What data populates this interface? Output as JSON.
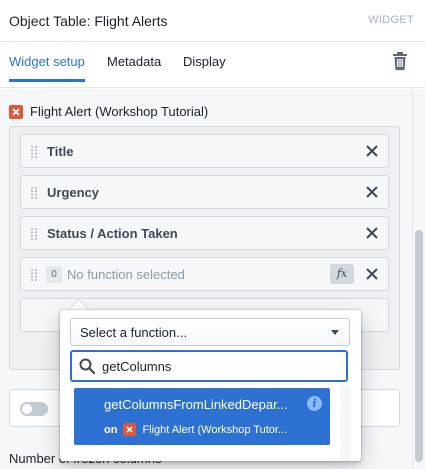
{
  "header": {
    "title": "Object Table: Flight Alerts",
    "badge": "WIDGET"
  },
  "tabs": [
    {
      "label": "Widget setup",
      "active": true
    },
    {
      "label": "Metadata",
      "active": false
    },
    {
      "label": "Display",
      "active": false
    }
  ],
  "object_type": {
    "label": "Flight Alert (Workshop Tutorial)"
  },
  "columns": [
    {
      "label": "Title"
    },
    {
      "label": "Urgency"
    },
    {
      "label": "Status / Action Taken"
    }
  ],
  "function_column": {
    "index": "0",
    "label": "No function selected",
    "fx": "fx"
  },
  "popover": {
    "select_value": "Select a function...",
    "search_value": "getColumns",
    "result": {
      "name": "getColumnsFromLinkedDepar...",
      "on_label": "on",
      "object": "Flight Alert (Workshop Tutor..."
    }
  },
  "frozen_columns_label": "Number of frozen columns",
  "colors": {
    "accent": "#2d72d2",
    "object_icon": "#e0573a"
  }
}
